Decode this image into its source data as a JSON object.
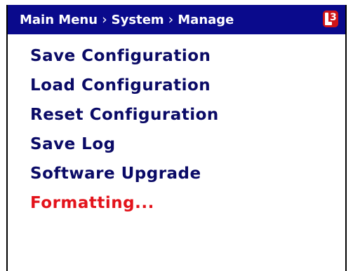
{
  "header": {
    "breadcrumb": [
      "Main Menu",
      "System",
      "Manage"
    ],
    "separator": "›",
    "logo_text": "L3",
    "bar_color": "#0a0a8c"
  },
  "menu": {
    "items": [
      {
        "label": "Save Configuration",
        "state": "normal"
      },
      {
        "label": "Load Configuration",
        "state": "normal"
      },
      {
        "label": "Reset Configuration",
        "state": "normal"
      },
      {
        "label": "Save Log",
        "state": "normal"
      },
      {
        "label": "Software Upgrade",
        "state": "normal"
      },
      {
        "label": "Formatting...",
        "state": "active"
      }
    ],
    "normal_color": "#0a0a66",
    "active_color": "#e3131b"
  }
}
